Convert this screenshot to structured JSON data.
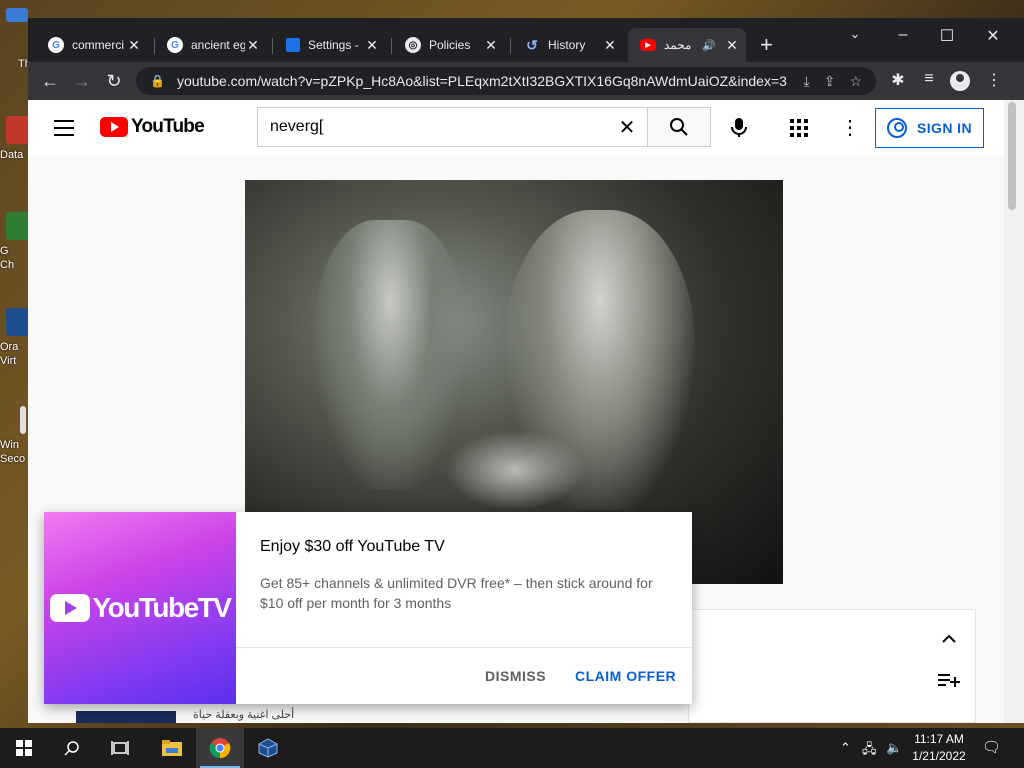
{
  "desktop": {
    "icons": [
      {
        "name": "desktop-icon-data",
        "label": "Data",
        "color": "#c0392b"
      },
      {
        "name": "desktop-icon-chrome",
        "label": "G",
        "label2": "Ch",
        "color": "#2e7d32"
      },
      {
        "name": "desktop-icon-oracle-vm",
        "label": "Ora",
        "label2": "Virt",
        "color": "#1f4e8c"
      },
      {
        "name": "desktop-icon-windows-security",
        "label": "Win",
        "label2": "Seco",
        "color": "#e0e0e0"
      }
    ],
    "top_label": "Th"
  },
  "browser": {
    "tabs": [
      {
        "label": "commerci",
        "favicon": "google-icon"
      },
      {
        "label": "ancient eg",
        "favicon": "google-icon"
      },
      {
        "label": "Settings -",
        "favicon": "settings-grid-icon"
      },
      {
        "label": "Policies",
        "favicon": "globe-icon"
      },
      {
        "label": "History",
        "favicon": "history-icon"
      },
      {
        "label": "محمد",
        "favicon": "youtube-icon",
        "active": true
      }
    ],
    "url": "youtube.com/watch?v=pZPKp_Hc8Ao&list=PLEqxm2tXtI32BGXTIX16Gq8nAWdmUaiOZ&index=3"
  },
  "youtube": {
    "logo_text": "YouTube",
    "search_value": "neverg[",
    "sign_in_label": "SIGN IN",
    "accent_color": "#065fd4",
    "brand_color": "#ff0000"
  },
  "promo": {
    "logo_text": "YouTubeTV",
    "title": "Enjoy $30 off YouTube TV",
    "body": "Get 85+ channels & unlimited DVR free* – then stick around for $10 off per month for 3 months",
    "dismiss_label": "DISMISS",
    "claim_label": "CLAIM OFFER"
  },
  "playlist": {
    "thumb_text": "أحلى اغنية وبعقلة حياة"
  },
  "taskbar": {
    "time": "11:17 AM",
    "date": "1/21/2022"
  }
}
